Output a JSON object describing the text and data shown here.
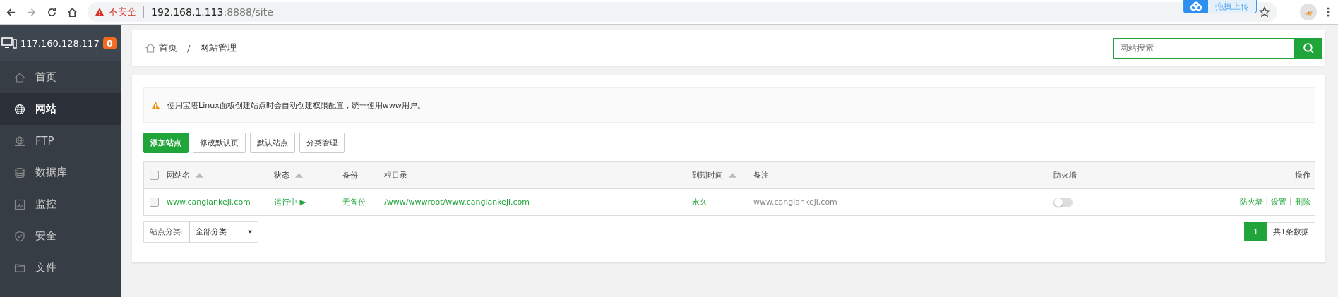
{
  "browser": {
    "forward_disabled": true,
    "security": "不安全",
    "url_host": "192.168.1.113",
    "url_rest": ":8888/site",
    "extension_label": "拖拽上传"
  },
  "sidebar": {
    "server": "117.160.128.117",
    "badge": "0",
    "items": [
      {
        "label": "首页",
        "selected": false
      },
      {
        "label": "网站",
        "selected": true
      },
      {
        "label": "FTP",
        "selected": false
      },
      {
        "label": "数据库",
        "selected": false
      },
      {
        "label": "监控",
        "selected": false
      },
      {
        "label": "安全",
        "selected": false
      },
      {
        "label": "文件",
        "selected": false
      }
    ]
  },
  "breadcrumb": [
    "首页",
    "/",
    "网站管理"
  ],
  "search": {
    "placeholder": "网站搜索"
  },
  "alert": "使用宝塔Linux面板创建站点时会自动创建权限配置，统一使用www用户。",
  "buttons": [
    {
      "label": "添加站点",
      "kind": "primary"
    },
    {
      "label": "修改默认页",
      "kind": "default"
    },
    {
      "label": "默认站点",
      "kind": "default"
    },
    {
      "label": "分类管理",
      "kind": "default"
    }
  ],
  "table": {
    "select_all_checked": false,
    "columns": [
      {
        "label": "网站名",
        "sortable": true
      },
      {
        "label": "状态",
        "sortable": true
      },
      {
        "label": "备份",
        "sortable": false
      },
      {
        "label": "根目录",
        "sortable": false
      },
      {
        "label": "到期时间",
        "sortable": true
      },
      {
        "label": "备注",
        "sortable": false
      },
      {
        "label": "防火墙",
        "sortable": false
      },
      {
        "label": "操作",
        "sortable": false
      }
    ],
    "rows": [
      {
        "checked": false,
        "name": "www.canglankeji.com",
        "status": "运行中",
        "status_icon": "▶",
        "backup": "无备份",
        "root": "/www/wwwroot/www.canglankeji.com",
        "expiry": "永久",
        "note": "www.canglankeji.com",
        "firewall_on": false,
        "actions": [
          "防火墙",
          "|",
          "设置",
          "|",
          "删除"
        ]
      }
    ]
  },
  "category": {
    "label": "站点分类:",
    "value": "全部分类"
  },
  "pagination": {
    "pages": [
      {
        "label": "1",
        "selected": true
      }
    ],
    "total": "共1条数据"
  }
}
